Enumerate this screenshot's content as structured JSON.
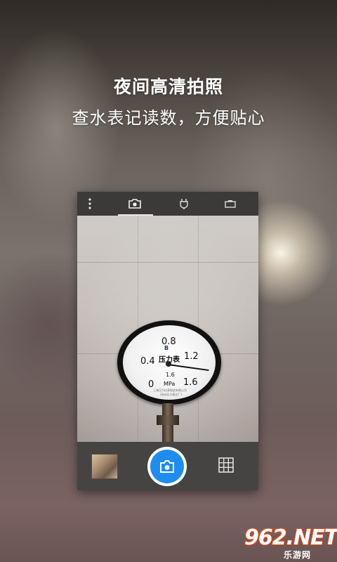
{
  "promo": {
    "headline": "夜间高清拍照",
    "subline": "查水表记读数，方便贴心"
  },
  "camera": {
    "tabs": [
      {
        "icon": "camera-icon",
        "active": true
      },
      {
        "icon": "plug-icon",
        "active": false
      },
      {
        "icon": "battery-icon",
        "active": false
      }
    ],
    "menu_icon": "more-vertical-icon",
    "shutter_icon": "camera-icon",
    "grid_icon": "grid-icon",
    "accent_color": "#1f8cf0"
  },
  "gauge": {
    "ticks": [
      "0.8",
      "0.4",
      "1.2",
      "0",
      "1.6"
    ],
    "title": "压力表",
    "unit": "MPa",
    "class_mark": "1.6",
    "maker_line1": "上海压力仪表制造有限公司",
    "maker_line2": "(杭州压力表总厂)",
    "logo": "B"
  },
  "watermark": {
    "brand": "962.NET",
    "sub": "乐游网"
  }
}
